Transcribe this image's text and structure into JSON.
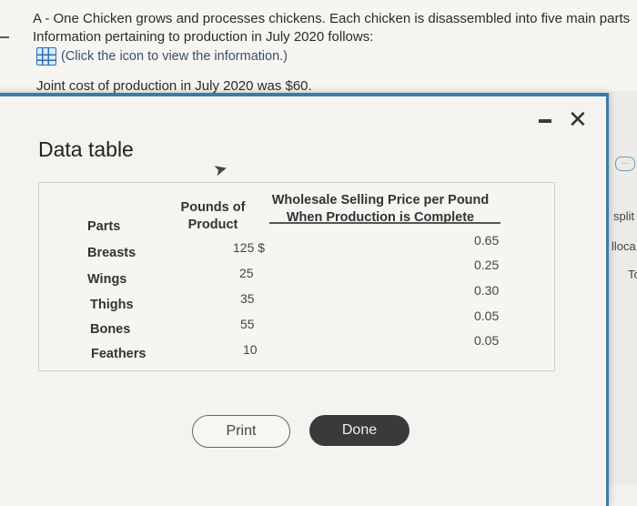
{
  "question": {
    "line1": "A - One Chicken grows and processes chickens. Each chicken is disassembled into five main parts",
    "line2": "Information pertaining to production in July 2020 follows:",
    "info_link": "(Click the icon to view the information.)",
    "joint_cost": "Joint cost of production in July 2020 was $60."
  },
  "modal": {
    "title": "Data table",
    "minimize_label": "–",
    "close_label": "✕",
    "table": {
      "headers": {
        "parts": "Parts",
        "pounds_line1": "Pounds of",
        "pounds_line2": "Product",
        "price_line1": "Wholesale Selling Price per Pound",
        "price_line2": "When Production is Complete"
      },
      "rows": [
        {
          "part": "Breasts",
          "pounds": "125 $",
          "price": "0.65"
        },
        {
          "part": "Wings",
          "pounds": "25",
          "price": "0.25"
        },
        {
          "part": "Thighs",
          "pounds": "35",
          "price": "0.30"
        },
        {
          "part": "Bones",
          "pounds": "55",
          "price": "0.05"
        },
        {
          "part": "Feathers",
          "pounds": "10",
          "price": "0.05"
        }
      ]
    },
    "buttons": {
      "print": "Print",
      "done": "Done"
    }
  },
  "side_panel": {
    "ellipsis": "...",
    "text1": "split",
    "text2": "lloca",
    "text3": "To"
  },
  "colors": {
    "accent": "#3a7ca5",
    "done_button": "#3a3a3a",
    "icon_blue": "#2f6fb0"
  }
}
